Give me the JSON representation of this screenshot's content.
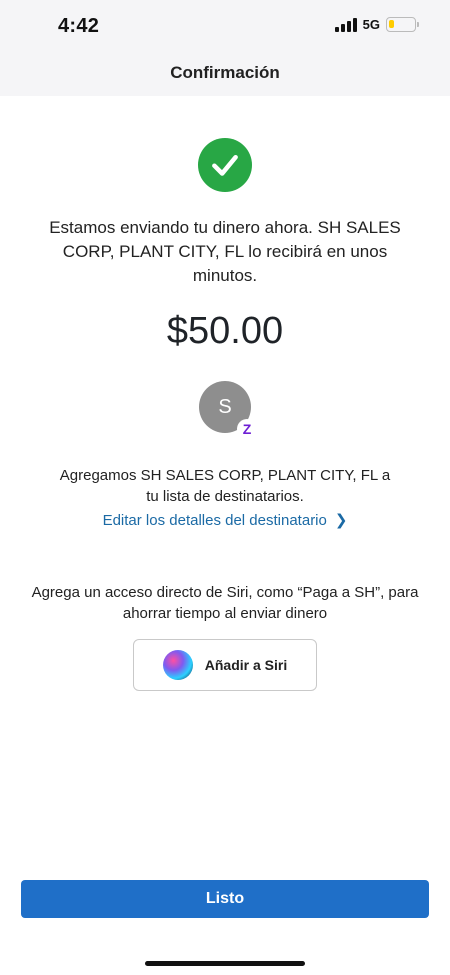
{
  "status_bar": {
    "time": "4:42",
    "network": "5G",
    "battery_level": 0.2,
    "battery_color": "#ffcc00"
  },
  "header": {
    "title": "Confirmación"
  },
  "confirmation": {
    "icon": "checkmark-icon",
    "message": "Estamos enviando tu dinero ahora. SH SALES CORP, PLANT CITY, FL lo recibirá en unos minutos.",
    "amount": "$50.00"
  },
  "recipient": {
    "avatar_initial": "S",
    "badge_letter": "Z",
    "added_text": "Agregamos SH SALES CORP, PLANT CITY, FL a tu lista de destinatarios.",
    "edit_link": "Editar los detalles del destinatario"
  },
  "siri": {
    "description": "Agrega un acceso directo de Siri, como “Paga a SH”, para ahorrar tiempo al enviar dinero",
    "button_label": "Añadir a Siri"
  },
  "footer": {
    "done_label": "Listo"
  },
  "colors": {
    "success": "#28a745",
    "link": "#1b6aa5",
    "primary_button": "#1f6fc8",
    "zelle": "#6d1ed4"
  }
}
